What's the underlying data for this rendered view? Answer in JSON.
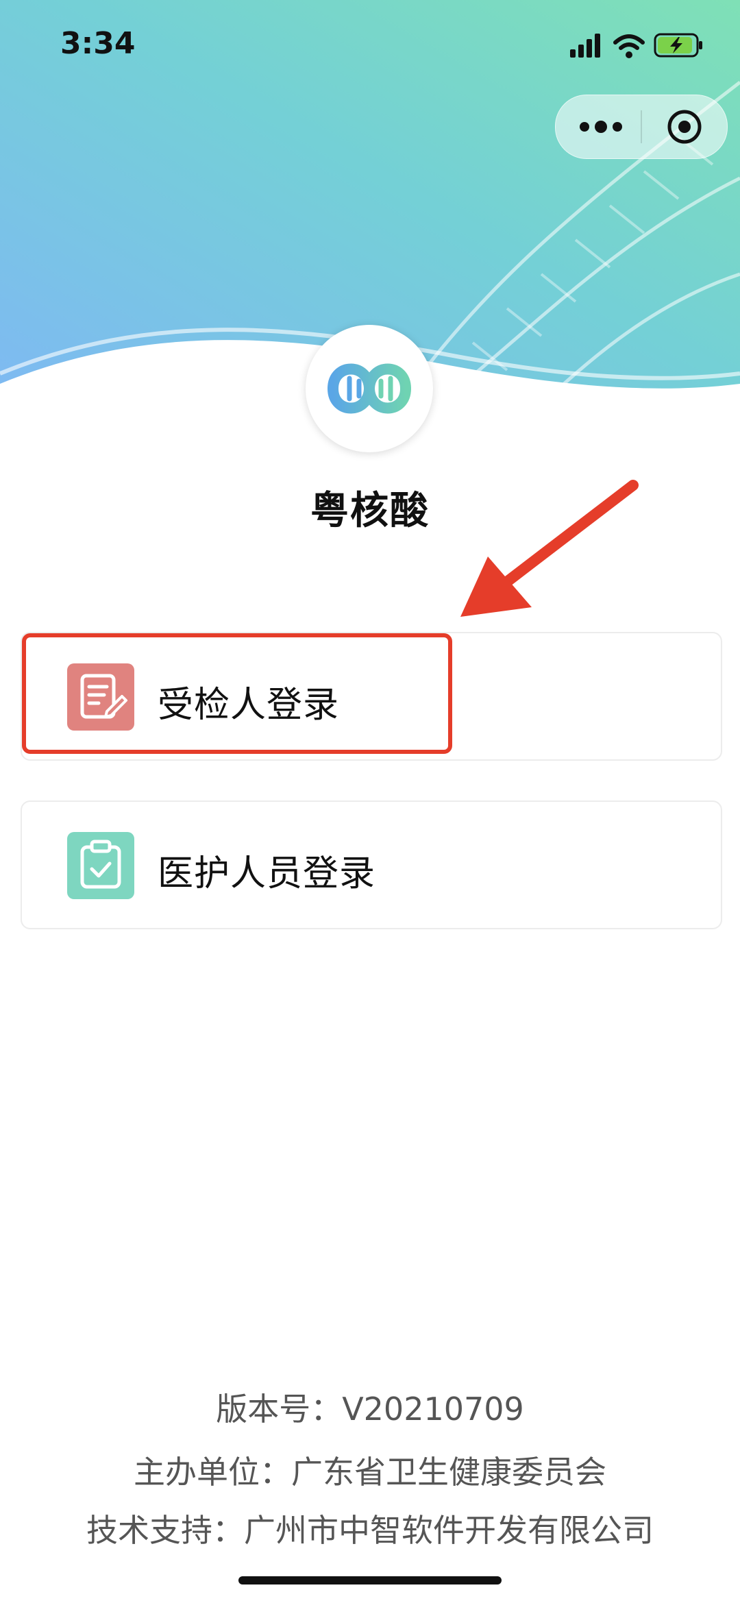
{
  "status_bar": {
    "time": "3:34",
    "signal_icon": "cellular-signal-icon",
    "wifi_icon": "wifi-icon",
    "battery_icon": "battery-charging-icon"
  },
  "mini_program_capsule": {
    "more_icon": "more-dots-icon",
    "close_icon": "target-close-icon"
  },
  "app": {
    "logo_icon": "dna-helix-logo-icon",
    "name": "粤核酸"
  },
  "login_options": [
    {
      "label": "受检人登录",
      "icon": "edit-document-icon",
      "icon_color": "#e0837f"
    },
    {
      "label": "医护人员登录",
      "icon": "clipboard-check-icon",
      "icon_color": "#7ed6c0"
    }
  ],
  "annotation": {
    "arrow_color": "#e53d2a",
    "highlight_color": "#e53d2a"
  },
  "footer": {
    "version": "版本号：V20210709",
    "organizer": "主办单位：广东省卫生健康委员会",
    "tech_support": "技术支持：广州市中智软件开发有限公司"
  }
}
